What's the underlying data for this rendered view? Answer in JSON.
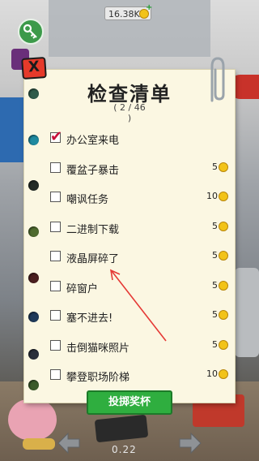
{
  "hud": {
    "coins": "16.38K"
  },
  "checklist": {
    "title": "检查清单",
    "progress_text": "( 2 / 46",
    "progress_close": ")",
    "items": [
      {
        "label": "办公室来电",
        "checked": true,
        "reward": ""
      },
      {
        "label": "覆盆子暴击",
        "checked": false,
        "reward": "5"
      },
      {
        "label": "嘲讽任务",
        "checked": false,
        "reward": "10"
      },
      {
        "label": "二进制下载",
        "checked": false,
        "reward": "5"
      },
      {
        "label": "液晶屏碎了",
        "checked": false,
        "reward": "5"
      },
      {
        "label": "碎窗户",
        "checked": false,
        "reward": "5"
      },
      {
        "label": "塞不进去!",
        "checked": false,
        "reward": "5"
      },
      {
        "label": "击倒猫咪照片",
        "checked": false,
        "reward": "5"
      },
      {
        "label": "攀登职场阶梯",
        "checked": false,
        "reward": "10"
      }
    ],
    "award_button": "投掷奖杯",
    "close_label": "X",
    "hole_colors": [
      "#2f5b4a",
      "#1f8aa0",
      "#232b27",
      "#4f6b2f",
      "#4a1f1f",
      "#1f3a5a",
      "#2a2f3a",
      "#3a5a2a"
    ]
  },
  "footer": {
    "version": "0.22"
  },
  "colors": {
    "accent_green": "#2fae3f",
    "close_red": "#e63a2a",
    "paper": "#fbf7e2",
    "check_red": "#c8103a"
  }
}
